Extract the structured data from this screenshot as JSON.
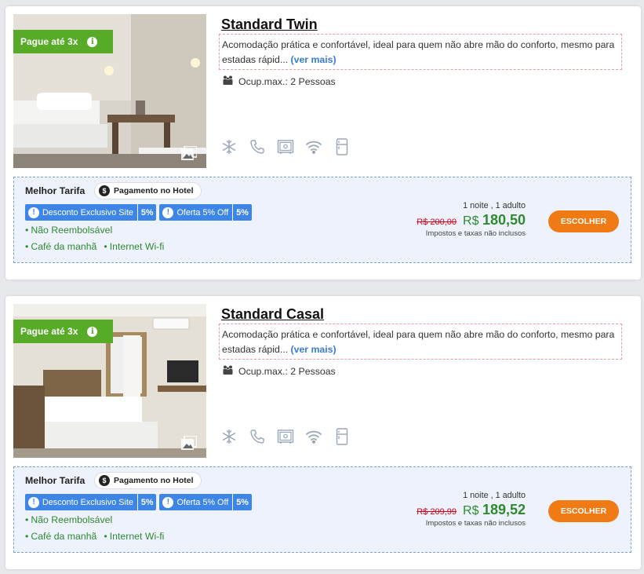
{
  "rooms": [
    {
      "promo_label": "Pague até 3x",
      "title": "Standard Twin",
      "description": "Acomodação prática e confortável, ideal para quem não abre mão do conforto, mesmo para estadas rápid...",
      "more_link": "(ver mais)",
      "occupancy": "Ocup.max.: 2 Pessoas",
      "amenities": [
        "snowflake-icon",
        "phone-icon",
        "safe-icon",
        "wifi-icon",
        "fridge-icon"
      ],
      "rate": {
        "name": "Melhor Tarifa",
        "payment_tag": "Pagamento no Hotel",
        "badges": [
          {
            "label": "Desconto Exclusivo Site",
            "value": "5%"
          },
          {
            "label": "Oferta 5% Off",
            "value": "5%"
          }
        ],
        "conditions": [
          "Não Reembolsável",
          "Café da manhã",
          "Internet Wi-fi"
        ],
        "stay": "1 noite , 1 adulto",
        "old_price": "R$ 200,00",
        "currency": "R$",
        "price": "180,50",
        "taxes": "Impostos e taxas não inclusos",
        "button": "ESCOLHER"
      }
    },
    {
      "promo_label": "Pague até 3x",
      "title": "Standard Casal",
      "description": "Acomodação prática e confortável, ideal para quem não abre mão do conforto, mesmo para estadas rápid...",
      "more_link": "(ver mais)",
      "occupancy": "Ocup.max.: 2 Pessoas",
      "amenities": [
        "snowflake-icon",
        "phone-icon",
        "safe-icon",
        "wifi-icon",
        "fridge-icon"
      ],
      "rate": {
        "name": "Melhor Tarifa",
        "payment_tag": "Pagamento no Hotel",
        "badges": [
          {
            "label": "Desconto Exclusivo Site",
            "value": "5%"
          },
          {
            "label": "Oferta 5% Off",
            "value": "5%"
          }
        ],
        "conditions": [
          "Não Reembolsável",
          "Café da manhã",
          "Internet Wi-fi"
        ],
        "stay": "1 noite , 1 adulto",
        "old_price": "R$ 209,99",
        "currency": "R$",
        "price": "189,52",
        "taxes": "Impostos e taxas não inclusos",
        "button": "ESCOLHER"
      }
    }
  ],
  "colors": {
    "promo_green": "#57ab27",
    "price_green": "#2f8a2f",
    "old_price_red": "#d0021b",
    "button_orange": "#f07a14",
    "badge_blue": "#3d86e8",
    "link_blue": "#3a7bd5"
  }
}
